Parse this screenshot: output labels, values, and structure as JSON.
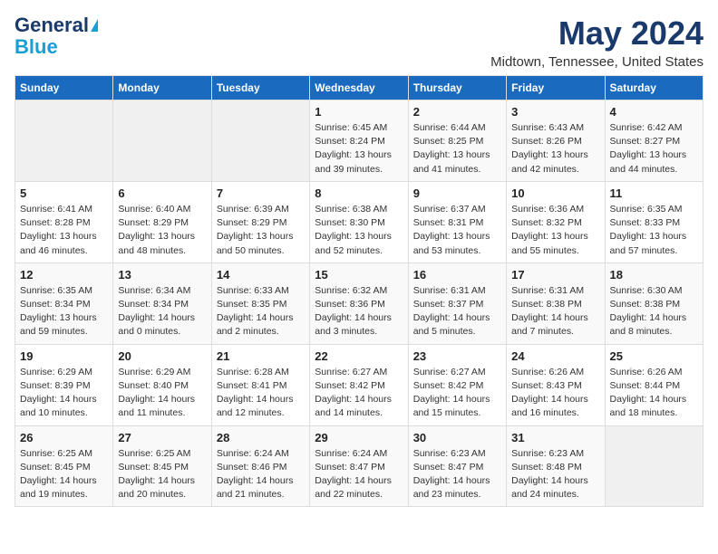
{
  "header": {
    "logo_line1": "General",
    "logo_line2": "Blue",
    "title": "May 2024",
    "subtitle": "Midtown, Tennessee, United States"
  },
  "weekdays": [
    "Sunday",
    "Monday",
    "Tuesday",
    "Wednesday",
    "Thursday",
    "Friday",
    "Saturday"
  ],
  "weeks": [
    [
      {
        "num": "",
        "sunrise": "",
        "sunset": "",
        "daylight": "",
        "empty": true
      },
      {
        "num": "",
        "sunrise": "",
        "sunset": "",
        "daylight": "",
        "empty": true
      },
      {
        "num": "",
        "sunrise": "",
        "sunset": "",
        "daylight": "",
        "empty": true
      },
      {
        "num": "1",
        "sunrise": "Sunrise: 6:45 AM",
        "sunset": "Sunset: 8:24 PM",
        "daylight": "Daylight: 13 hours and 39 minutes.",
        "empty": false
      },
      {
        "num": "2",
        "sunrise": "Sunrise: 6:44 AM",
        "sunset": "Sunset: 8:25 PM",
        "daylight": "Daylight: 13 hours and 41 minutes.",
        "empty": false
      },
      {
        "num": "3",
        "sunrise": "Sunrise: 6:43 AM",
        "sunset": "Sunset: 8:26 PM",
        "daylight": "Daylight: 13 hours and 42 minutes.",
        "empty": false
      },
      {
        "num": "4",
        "sunrise": "Sunrise: 6:42 AM",
        "sunset": "Sunset: 8:27 PM",
        "daylight": "Daylight: 13 hours and 44 minutes.",
        "empty": false
      }
    ],
    [
      {
        "num": "5",
        "sunrise": "Sunrise: 6:41 AM",
        "sunset": "Sunset: 8:28 PM",
        "daylight": "Daylight: 13 hours and 46 minutes.",
        "empty": false
      },
      {
        "num": "6",
        "sunrise": "Sunrise: 6:40 AM",
        "sunset": "Sunset: 8:29 PM",
        "daylight": "Daylight: 13 hours and 48 minutes.",
        "empty": false
      },
      {
        "num": "7",
        "sunrise": "Sunrise: 6:39 AM",
        "sunset": "Sunset: 8:29 PM",
        "daylight": "Daylight: 13 hours and 50 minutes.",
        "empty": false
      },
      {
        "num": "8",
        "sunrise": "Sunrise: 6:38 AM",
        "sunset": "Sunset: 8:30 PM",
        "daylight": "Daylight: 13 hours and 52 minutes.",
        "empty": false
      },
      {
        "num": "9",
        "sunrise": "Sunrise: 6:37 AM",
        "sunset": "Sunset: 8:31 PM",
        "daylight": "Daylight: 13 hours and 53 minutes.",
        "empty": false
      },
      {
        "num": "10",
        "sunrise": "Sunrise: 6:36 AM",
        "sunset": "Sunset: 8:32 PM",
        "daylight": "Daylight: 13 hours and 55 minutes.",
        "empty": false
      },
      {
        "num": "11",
        "sunrise": "Sunrise: 6:35 AM",
        "sunset": "Sunset: 8:33 PM",
        "daylight": "Daylight: 13 hours and 57 minutes.",
        "empty": false
      }
    ],
    [
      {
        "num": "12",
        "sunrise": "Sunrise: 6:35 AM",
        "sunset": "Sunset: 8:34 PM",
        "daylight": "Daylight: 13 hours and 59 minutes.",
        "empty": false
      },
      {
        "num": "13",
        "sunrise": "Sunrise: 6:34 AM",
        "sunset": "Sunset: 8:34 PM",
        "daylight": "Daylight: 14 hours and 0 minutes.",
        "empty": false
      },
      {
        "num": "14",
        "sunrise": "Sunrise: 6:33 AM",
        "sunset": "Sunset: 8:35 PM",
        "daylight": "Daylight: 14 hours and 2 minutes.",
        "empty": false
      },
      {
        "num": "15",
        "sunrise": "Sunrise: 6:32 AM",
        "sunset": "Sunset: 8:36 PM",
        "daylight": "Daylight: 14 hours and 3 minutes.",
        "empty": false
      },
      {
        "num": "16",
        "sunrise": "Sunrise: 6:31 AM",
        "sunset": "Sunset: 8:37 PM",
        "daylight": "Daylight: 14 hours and 5 minutes.",
        "empty": false
      },
      {
        "num": "17",
        "sunrise": "Sunrise: 6:31 AM",
        "sunset": "Sunset: 8:38 PM",
        "daylight": "Daylight: 14 hours and 7 minutes.",
        "empty": false
      },
      {
        "num": "18",
        "sunrise": "Sunrise: 6:30 AM",
        "sunset": "Sunset: 8:38 PM",
        "daylight": "Daylight: 14 hours and 8 minutes.",
        "empty": false
      }
    ],
    [
      {
        "num": "19",
        "sunrise": "Sunrise: 6:29 AM",
        "sunset": "Sunset: 8:39 PM",
        "daylight": "Daylight: 14 hours and 10 minutes.",
        "empty": false
      },
      {
        "num": "20",
        "sunrise": "Sunrise: 6:29 AM",
        "sunset": "Sunset: 8:40 PM",
        "daylight": "Daylight: 14 hours and 11 minutes.",
        "empty": false
      },
      {
        "num": "21",
        "sunrise": "Sunrise: 6:28 AM",
        "sunset": "Sunset: 8:41 PM",
        "daylight": "Daylight: 14 hours and 12 minutes.",
        "empty": false
      },
      {
        "num": "22",
        "sunrise": "Sunrise: 6:27 AM",
        "sunset": "Sunset: 8:42 PM",
        "daylight": "Daylight: 14 hours and 14 minutes.",
        "empty": false
      },
      {
        "num": "23",
        "sunrise": "Sunrise: 6:27 AM",
        "sunset": "Sunset: 8:42 PM",
        "daylight": "Daylight: 14 hours and 15 minutes.",
        "empty": false
      },
      {
        "num": "24",
        "sunrise": "Sunrise: 6:26 AM",
        "sunset": "Sunset: 8:43 PM",
        "daylight": "Daylight: 14 hours and 16 minutes.",
        "empty": false
      },
      {
        "num": "25",
        "sunrise": "Sunrise: 6:26 AM",
        "sunset": "Sunset: 8:44 PM",
        "daylight": "Daylight: 14 hours and 18 minutes.",
        "empty": false
      }
    ],
    [
      {
        "num": "26",
        "sunrise": "Sunrise: 6:25 AM",
        "sunset": "Sunset: 8:45 PM",
        "daylight": "Daylight: 14 hours and 19 minutes.",
        "empty": false
      },
      {
        "num": "27",
        "sunrise": "Sunrise: 6:25 AM",
        "sunset": "Sunset: 8:45 PM",
        "daylight": "Daylight: 14 hours and 20 minutes.",
        "empty": false
      },
      {
        "num": "28",
        "sunrise": "Sunrise: 6:24 AM",
        "sunset": "Sunset: 8:46 PM",
        "daylight": "Daylight: 14 hours and 21 minutes.",
        "empty": false
      },
      {
        "num": "29",
        "sunrise": "Sunrise: 6:24 AM",
        "sunset": "Sunset: 8:47 PM",
        "daylight": "Daylight: 14 hours and 22 minutes.",
        "empty": false
      },
      {
        "num": "30",
        "sunrise": "Sunrise: 6:23 AM",
        "sunset": "Sunset: 8:47 PM",
        "daylight": "Daylight: 14 hours and 23 minutes.",
        "empty": false
      },
      {
        "num": "31",
        "sunrise": "Sunrise: 6:23 AM",
        "sunset": "Sunset: 8:48 PM",
        "daylight": "Daylight: 14 hours and 24 minutes.",
        "empty": false
      },
      {
        "num": "",
        "sunrise": "",
        "sunset": "",
        "daylight": "",
        "empty": true
      }
    ]
  ]
}
